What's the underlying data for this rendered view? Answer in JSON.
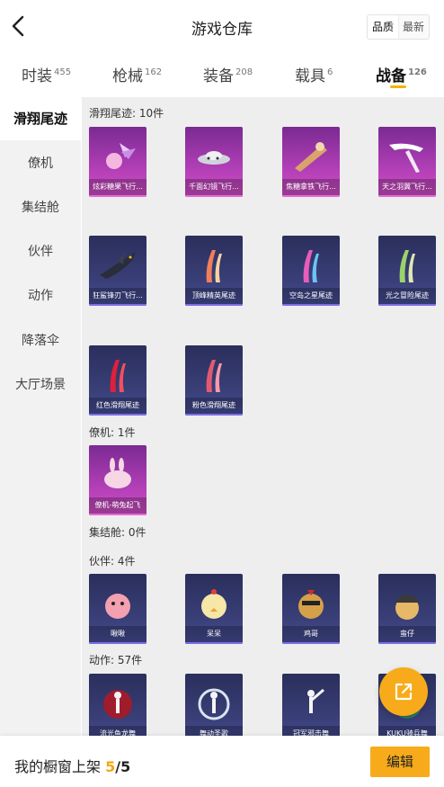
{
  "header": {
    "title": "游戏仓库",
    "sort_options": [
      "品质",
      "最新"
    ]
  },
  "tabs": [
    {
      "label": "时装",
      "count": "455"
    },
    {
      "label": "枪械",
      "count": "162"
    },
    {
      "label": "装备",
      "count": "208"
    },
    {
      "label": "载具",
      "count": "6"
    },
    {
      "label": "战备",
      "count": "126"
    }
  ],
  "sidebar": {
    "items": [
      "滑翔尾迹",
      "僚机",
      "集结舱",
      "伙伴",
      "动作",
      "降落伞",
      "大厅场景"
    ]
  },
  "sections": {
    "trail": {
      "title": "滑翔尾迹: 10件",
      "items": [
        "炫彩糖果飞行...",
        "千面幻镜飞行...",
        "焦糖拿铁飞行...",
        "天之羽翼飞行...",
        "狂鲨锋刃飞行...",
        "顶峰精英尾迹",
        "空岛之星尾迹",
        "光之冒险尾迹",
        "红色滑翔尾迹",
        "粉色滑翔尾迹"
      ]
    },
    "wingman": {
      "title": "僚机: 1件",
      "items": [
        "僚机-萌兔起飞"
      ]
    },
    "pod": {
      "title": "集结舱: 0件"
    },
    "partner": {
      "title": "伙伴: 4件",
      "items": [
        "啾啾",
        "呆呆",
        "鸡哥",
        "蛮仔"
      ]
    },
    "emote": {
      "title": "动作: 57件",
      "items": [
        "流光鱼龙舞",
        "舞动圣歌",
        "冠军邪击舞",
        "KUKU骑兵舞"
      ]
    }
  },
  "footer": {
    "label": "我的橱窗上架",
    "count": "5",
    "total": "/5",
    "edit_label": "编辑"
  },
  "colors": {
    "accent": "#f7ab1a",
    "rarity_purple": "#b23fb6",
    "rarity_blue": "#3a3f78"
  },
  "icons": {
    "back": "chevron-left-icon",
    "fab": "share-external-icon"
  }
}
